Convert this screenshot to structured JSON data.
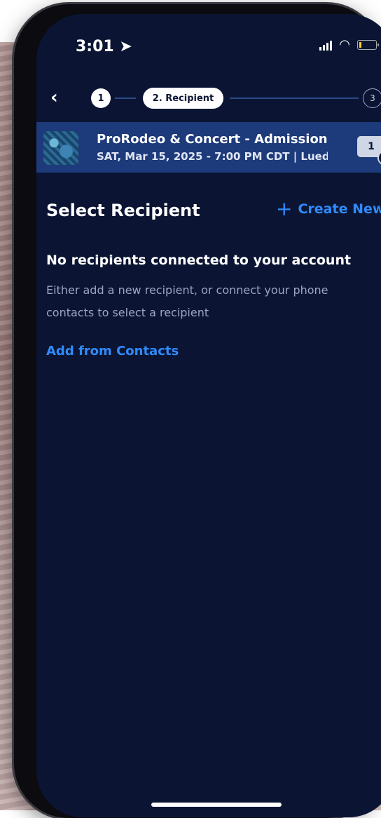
{
  "status_bar": {
    "time": "3:01",
    "location_icon": "location-arrow-icon",
    "signal_icon": "signal-icon",
    "wifi_icon": "wifi-icon",
    "battery_icon": "battery-icon"
  },
  "stepper": {
    "back_icon": "chevron-left-icon",
    "step1": "1",
    "step2": "2. Recipient",
    "step3": "3"
  },
  "event": {
    "title": "ProRodeo & Concert - Admission",
    "subtitle": "SAT, Mar 15, 2025 - 7:00 PM CDT | Lued",
    "ticket_count": "1"
  },
  "content": {
    "section_title": "Select Recipient",
    "create_new": "Create New",
    "empty_title": "No recipients connected to your account",
    "empty_desc": "Either add a new recipient, or connect your phone contacts to select a recipient",
    "add_contacts": "Add from Contacts"
  },
  "colors": {
    "background": "#0b1533",
    "event_bar": "#1d3a7a",
    "accent": "#2f8bff"
  }
}
